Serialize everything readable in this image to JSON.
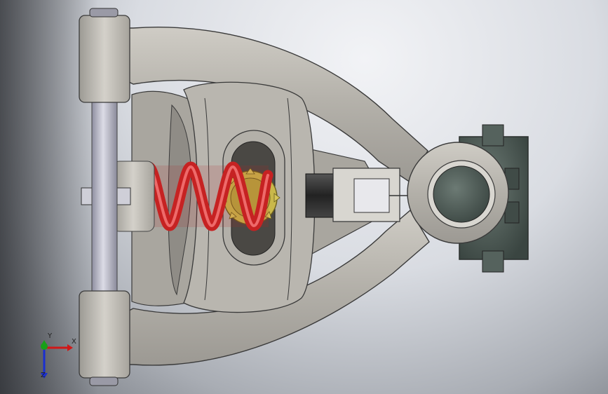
{
  "viewport": {
    "background": "#dfe2e7",
    "part_color": "#bdbab3",
    "part_edge": "#3a3a3a",
    "spring_color": "#d42a2a",
    "gear_color": "#c9b84a",
    "shaft_color": "#b9b9c8",
    "hub_color": "#4f5a55"
  },
  "triad": {
    "x_label": "X",
    "y_label": "Y",
    "z_label": "Z",
    "x_color": "#d01818",
    "y_color": "#18a018",
    "z_color": "#1a2fd0"
  }
}
